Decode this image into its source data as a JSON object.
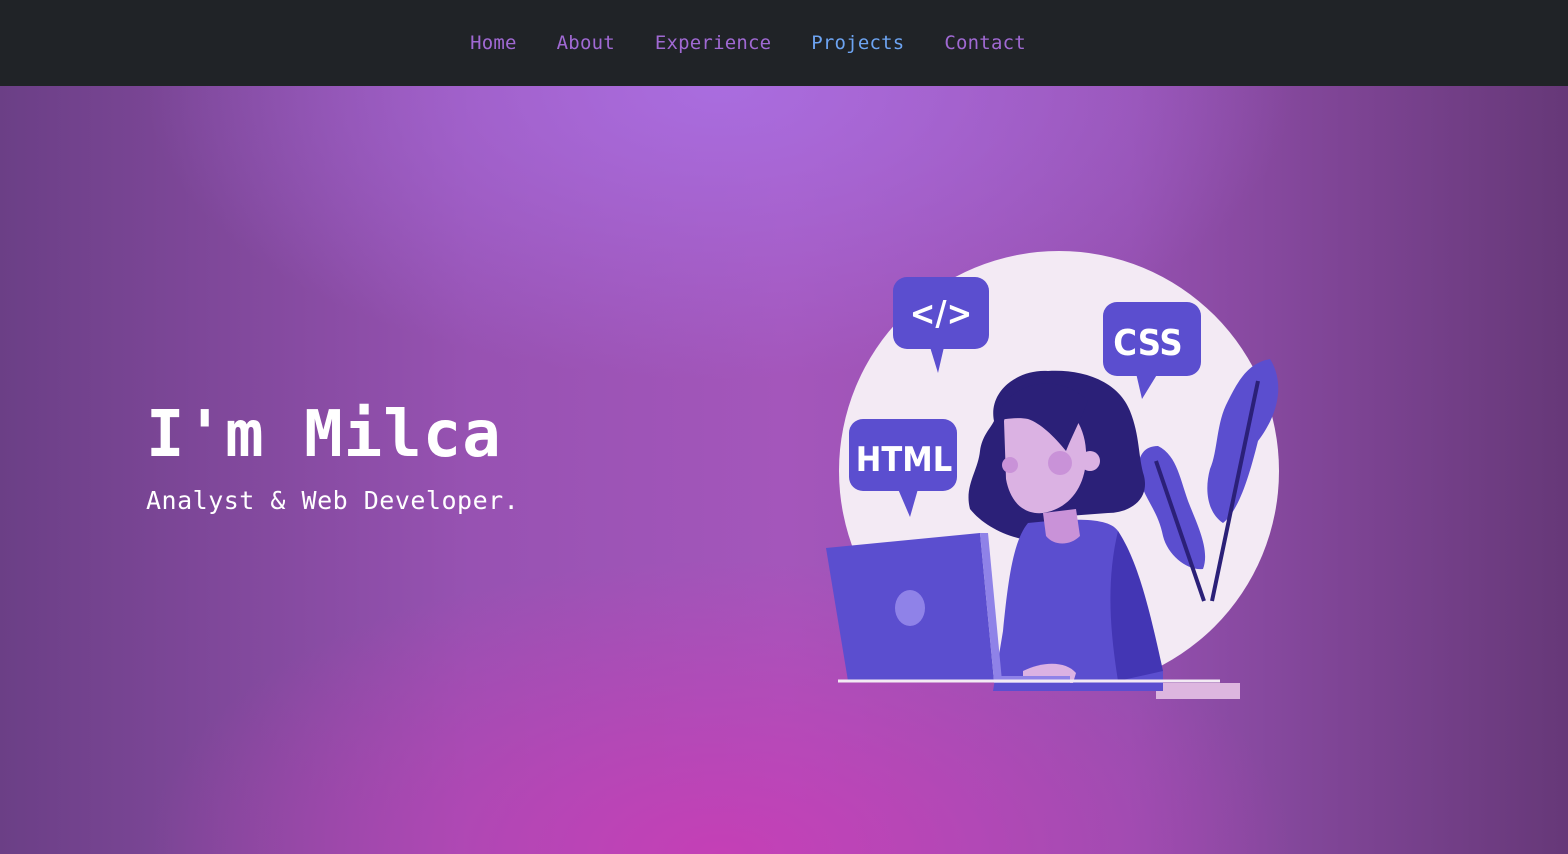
{
  "nav": {
    "items": [
      {
        "label": "Home",
        "active": false
      },
      {
        "label": "About",
        "active": false
      },
      {
        "label": "Experience",
        "active": false
      },
      {
        "label": "Projects",
        "active": true
      },
      {
        "label": "Contact",
        "active": false
      }
    ]
  },
  "hero": {
    "title": "I'm Milca",
    "subtitle": "Analyst & Web Developer."
  },
  "illustration": {
    "bubble_code": "</>",
    "bubble_css": "CSS",
    "bubble_html": "HTML"
  },
  "colors": {
    "navbar_bg": "#202327",
    "nav_link": "#a069d3",
    "nav_link_active": "#6da4f2",
    "hero_accent": "#5b4ecf",
    "text": "#ffffff"
  }
}
